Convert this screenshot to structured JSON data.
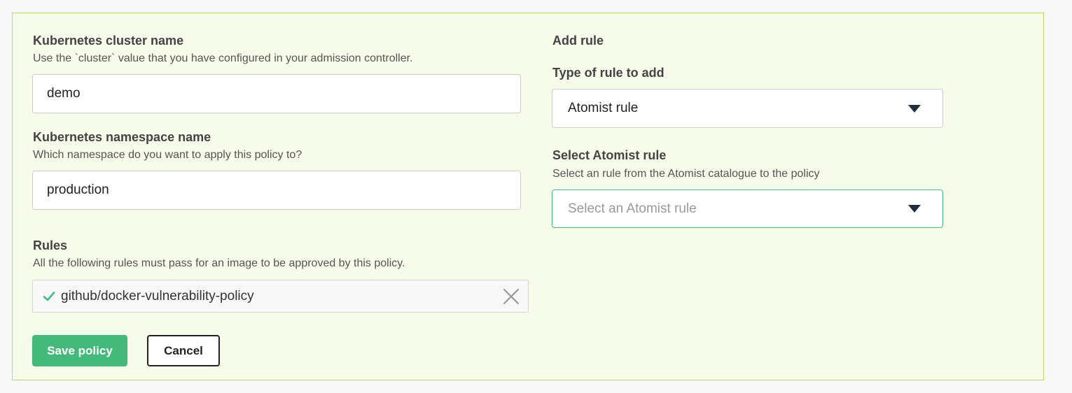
{
  "cluster": {
    "label": "Kubernetes cluster name",
    "hint": "Use the `cluster` value that you have configured in your admission controller.",
    "value": "demo"
  },
  "namespace": {
    "label": "Kubernetes namespace name",
    "hint": "Which namespace do you want to apply this policy to?",
    "value": "production"
  },
  "rules": {
    "label": "Rules",
    "hint": "All the following rules must pass for an image to be approved by this policy.",
    "items": [
      {
        "name": "github/docker-vulnerability-policy",
        "icon": "check-icon",
        "remove_icon": "close-icon"
      }
    ]
  },
  "add_rule": {
    "heading": "Add rule",
    "type_label": "Type of rule to add",
    "type_value": "Atomist rule",
    "select_label": "Select Atomist rule",
    "select_hint": "Select an rule from the Atomist catalogue to the policy",
    "select_placeholder": "Select an Atomist rule"
  },
  "actions": {
    "save_label": "Save policy",
    "cancel_label": "Cancel"
  },
  "colors": {
    "panel_bg": "#f6fce9",
    "panel_border": "#b5d96a",
    "primary": "#45b97c",
    "caret": "#1f2d3d"
  }
}
